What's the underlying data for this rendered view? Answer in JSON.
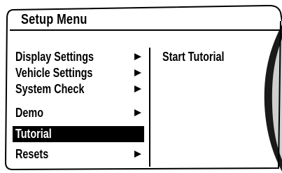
{
  "header": {
    "title": "Setup Menu"
  },
  "menu": {
    "items": [
      {
        "label": "Display Settings",
        "has_submenu": true
      },
      {
        "label": "Vehicle Settings",
        "has_submenu": true
      },
      {
        "label": "System Check",
        "has_submenu": true
      },
      {
        "label": "Demo",
        "has_submenu": true
      },
      {
        "label": "Tutorial",
        "has_submenu": false,
        "selected": true
      },
      {
        "label": "Resets",
        "has_submenu": true
      }
    ]
  },
  "submenu": {
    "items": [
      {
        "label": "Start Tutorial"
      }
    ]
  },
  "colors": {
    "highlight": "#000000",
    "highlight_text": "#ffffff",
    "text": "#000000"
  },
  "icons": {
    "submenu_indicator": "triangle-right-icon"
  }
}
